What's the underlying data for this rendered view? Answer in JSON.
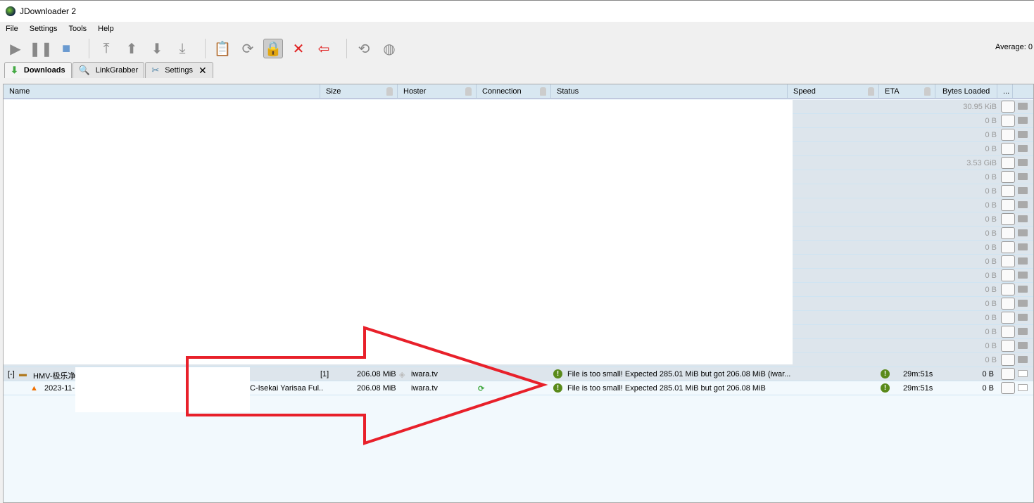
{
  "window": {
    "title": "JDownloader 2"
  },
  "menu": [
    "File",
    "Settings",
    "Tools",
    "Help"
  ],
  "toolbar": {
    "average_label": "Average: 0"
  },
  "tabs": [
    {
      "label": "Downloads",
      "icon": "download-arrow-icon"
    },
    {
      "label": "LinkGrabber",
      "icon": "magnifier-icon"
    },
    {
      "label": "Settings",
      "icon": "tools-icon"
    }
  ],
  "columns": {
    "name": "Name",
    "size": "Size",
    "hoster": "Hoster",
    "connection": "Connection",
    "status": "Status",
    "speed": "Speed",
    "eta": "ETA",
    "bytes_loaded": "Bytes Loaded",
    "more": "..."
  },
  "background_rows": [
    "30.95 KiB",
    "0 B",
    "0 B",
    "0 B",
    "3.53 GiB",
    "0 B",
    "0 B",
    "0 B",
    "0 B",
    "0 B",
    "0 B",
    "0 B",
    "0 B",
    "0 B",
    "0 B",
    "0 B",
    "0 B",
    "0 B",
    "0 B"
  ],
  "package": {
    "expander": "[-]",
    "name": "HMV-极乐净",
    "count": "[1]",
    "size": "206.08 MiB",
    "hoster": "iwara.tv",
    "status": "File is too small! Expected 285.01 MiB but got 206.08 MiB (iwar...",
    "eta": "29m:51s",
    "bytes_loaded": "0 B"
  },
  "link": {
    "name_start": "2023-11-",
    "name_end": "C-Isekai Yarisaa Ful..",
    "size": "206.08 MiB",
    "hoster": "iwara.tv",
    "status": "File is too small! Expected 285.01 MiB but got 206.08 MiB",
    "eta": "29m:51s",
    "bytes_loaded": "0 B"
  },
  "colors": {
    "annotation_arrow": "#e8202a",
    "status_warning": "#5a8a1a",
    "header_bg": "#d8e7f1"
  }
}
